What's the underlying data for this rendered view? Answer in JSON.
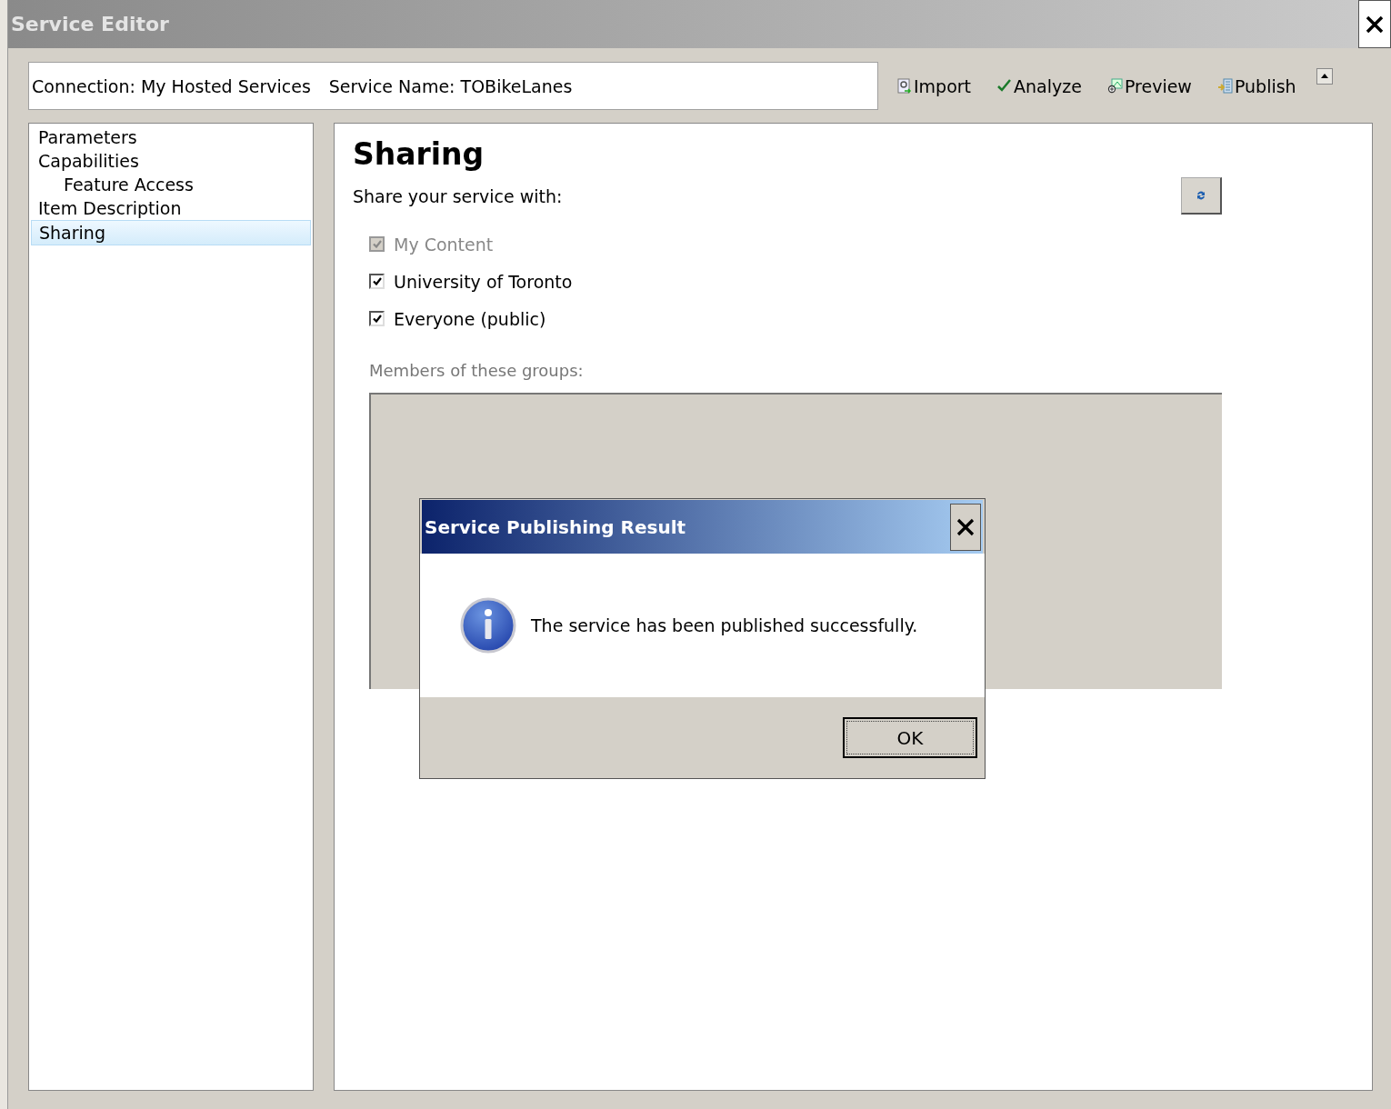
{
  "window": {
    "title": "Service Editor"
  },
  "header": {
    "connection": "Connection: My Hosted Services",
    "service_name": "Service Name: TOBikeLanes"
  },
  "toolbar": [
    {
      "label": "Import",
      "kind": "import"
    },
    {
      "label": "Analyze",
      "kind": "analyze"
    },
    {
      "label": "Preview",
      "kind": "preview"
    },
    {
      "label": "Publish",
      "kind": "publish"
    }
  ],
  "sidebar": {
    "items": [
      {
        "label": "Parameters",
        "selected": false
      },
      {
        "label": "Capabilities",
        "selected": false,
        "children": [
          {
            "label": "Feature Access",
            "selected": false
          }
        ]
      },
      {
        "label": "Item Description",
        "selected": false
      },
      {
        "label": "Sharing",
        "selected": true
      }
    ]
  },
  "content": {
    "heading": "Sharing",
    "share_label": "Share your service with:",
    "options": [
      {
        "label": "My Content",
        "checked": true,
        "disabled": true
      },
      {
        "label": "University of Toronto",
        "checked": true,
        "disabled": false
      },
      {
        "label": "Everyone (public)",
        "checked": true,
        "disabled": false
      }
    ],
    "groups_label": "Members of these groups:"
  },
  "dialog": {
    "title": "Service Publishing Result",
    "message": "The service has been published successfully.",
    "buttons": [
      "OK"
    ]
  }
}
